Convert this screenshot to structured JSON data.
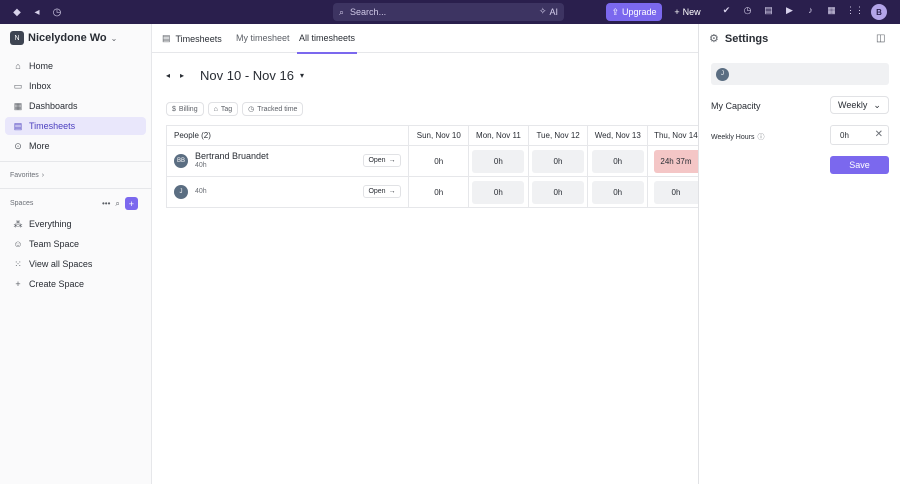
{
  "topbar": {
    "search_placeholder": "Search...",
    "ai_label": "AI",
    "upgrade_label": "Upgrade",
    "new_label": "New",
    "user_initial": "B",
    "accent": "#7b68ee",
    "bg": "#2a1f4d"
  },
  "workspace": {
    "initial": "N",
    "name": "Nicelydone Wo"
  },
  "sidebar": {
    "nav": [
      {
        "label": "Home",
        "icon": "home-icon",
        "glyph": "⌂"
      },
      {
        "label": "Inbox",
        "icon": "inbox-icon",
        "glyph": "▭"
      },
      {
        "label": "Dashboards",
        "icon": "dashboards-icon",
        "glyph": "▦"
      },
      {
        "label": "Timesheets",
        "icon": "timesheets-icon",
        "glyph": "▤"
      },
      {
        "label": "More",
        "icon": "more-icon",
        "glyph": "⊙"
      }
    ],
    "favorites": "Favorites",
    "spaces": "Spaces",
    "tree": [
      {
        "label": "Everything",
        "icon": "everything-icon",
        "glyph": "⁂"
      },
      {
        "label": "Team Space",
        "icon": "user-icon",
        "glyph": "☺"
      },
      {
        "label": "View all Spaces",
        "icon": "spaces-icon",
        "glyph": "⁙"
      },
      {
        "label": "Create Space",
        "icon": "plus-icon",
        "glyph": "+"
      }
    ]
  },
  "main": {
    "title": "Timesheets",
    "tabs": [
      "My timesheet",
      "All timesheets"
    ],
    "date_range": "Nov 10 - Nov 16",
    "filters": [
      "Billing",
      "Tag",
      "Tracked time"
    ],
    "people_header": "People (2)",
    "days": [
      "Sun, Nov 10",
      "Mon, Nov 11",
      "Tue, Nov 12",
      "Wed, Nov 13",
      "Thu, Nov 14"
    ],
    "rows": [
      {
        "initials": "BB",
        "name": "Bertrand Bruandet",
        "hours": "40h",
        "open": "Open",
        "values": [
          "0h",
          "0h",
          "0h",
          "0h",
          "24h 37m"
        ]
      },
      {
        "initials": "J",
        "name": "",
        "hours": "40h",
        "open": "Open",
        "values": [
          "0h",
          "0h",
          "0h",
          "0h",
          "0h"
        ]
      }
    ]
  },
  "panel": {
    "title": "Settings",
    "user_initial": "J",
    "capacity_label": "My Capacity",
    "period": "Weekly",
    "weekly_hours_label": "Weekly Hours",
    "weekly_hours_value": "0h",
    "save_label": "Save"
  }
}
